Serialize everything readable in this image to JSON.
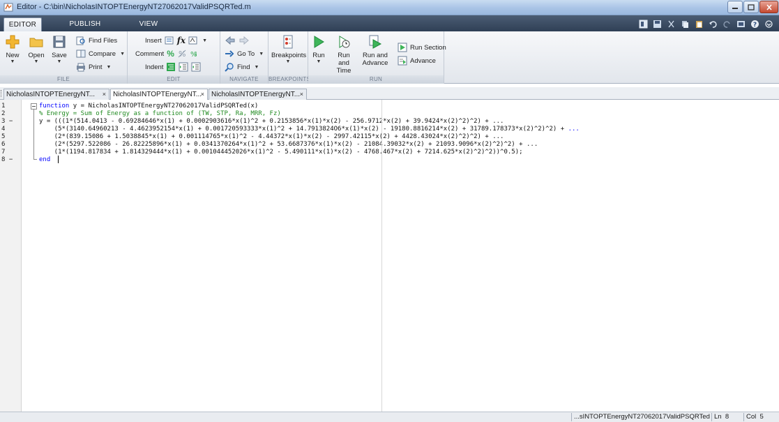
{
  "window": {
    "title": "Editor - C:\\bin\\NicholasINTOPTEnergyNT27062017ValidPSQRTed.m"
  },
  "ribbon_tabs": [
    "EDITOR",
    "PUBLISH",
    "VIEW"
  ],
  "ribbon": {
    "file": {
      "label": "FILE",
      "new": "New",
      "open": "Open",
      "save": "Save",
      "find_files": "Find Files",
      "compare": "Compare",
      "print": "Print"
    },
    "edit": {
      "label": "EDIT",
      "insert": "Insert",
      "comment": "Comment",
      "indent": "Indent",
      "fx": "fx"
    },
    "navigate": {
      "label": "NAVIGATE",
      "goto": "Go To",
      "find": "Find"
    },
    "breakpoints": {
      "label": "BREAKPOINTS",
      "breakpoints": "Breakpoints"
    },
    "run": {
      "label": "RUN",
      "run": "Run",
      "run_and_time_1": "Run and",
      "run_and_time_2": "Time",
      "run_and_advance_1": "Run and",
      "run_and_advance_2": "Advance",
      "run_section": "Run Section",
      "advance": "Advance"
    }
  },
  "doc_tabs": [
    "NicholasINTOPTEnergyNT...",
    "NicholasINTOPTEnergyNT...",
    "NicholasINTOPTEnergyNT..."
  ],
  "editor": {
    "line_numbers": [
      "1",
      "2",
      "3 −",
      "4",
      "5",
      "6",
      "7",
      "8 −"
    ],
    "lines": {
      "l1_kw": "function",
      "l1_rest": " y = NicholasINTOPTEnergyNT27062017ValidPSQRTed(x)",
      "l2_comment": "% Energy = Sum of Energy as a function of (TW, STP, Ra, MRR, Fz)",
      "l3": "y = (((1*(514.0413 - 0.69284646*x(1) + 0.0002903616*x(1)^2 + 0.2153856*x(1)*x(2) - 256.9712*x(2) + 39.9424*x(2)^2)^2) + ...",
      "l4_code": "    (5*(3140.64960213 - 4.4623952154*x(1) + 0.001720593333*x(1)^2 + 14.7913824O6*x(1)*x(2) - 19180.8816214*x(2) + 31789.178373*x(2)^2)^2) + ",
      "l4_cont": "...",
      "l5": "    (2*(839.15086 + 1.5038845*x(1) + 0.001114765*x(1)^2 - 4.44372*x(1)*x(2) - 2997.42115*x(2) + 4428.43024*x(2)^2)^2) + ...",
      "l6": "    (2*(5297.522086 - 26.82225896*x(1) + 0.0341370264*x(1)^2 + 53.6687376*x(1)*x(2) - 21084.39032*x(2) + 21093.9096*x(2)^2)^2) + ...",
      "l7": "    (1*(1194.817834 + 1.814329444*x(1) + 0.001044452026*x(1)^2 - 5.490111*x(1)*x(2) - 4768.467*x(2) + 7214.625*x(2)^2)^2))^0.5);",
      "l8_kw": "end"
    }
  },
  "status": {
    "file": "...sINTOPTEnergyNT27062017ValidPSQRTed",
    "ln_label": "Ln",
    "ln": "8",
    "col_label": "Col",
    "col": "5"
  },
  "colors": {
    "keyword": "#0000ff",
    "comment": "#228b22",
    "accent_green": "#2fa84f"
  }
}
